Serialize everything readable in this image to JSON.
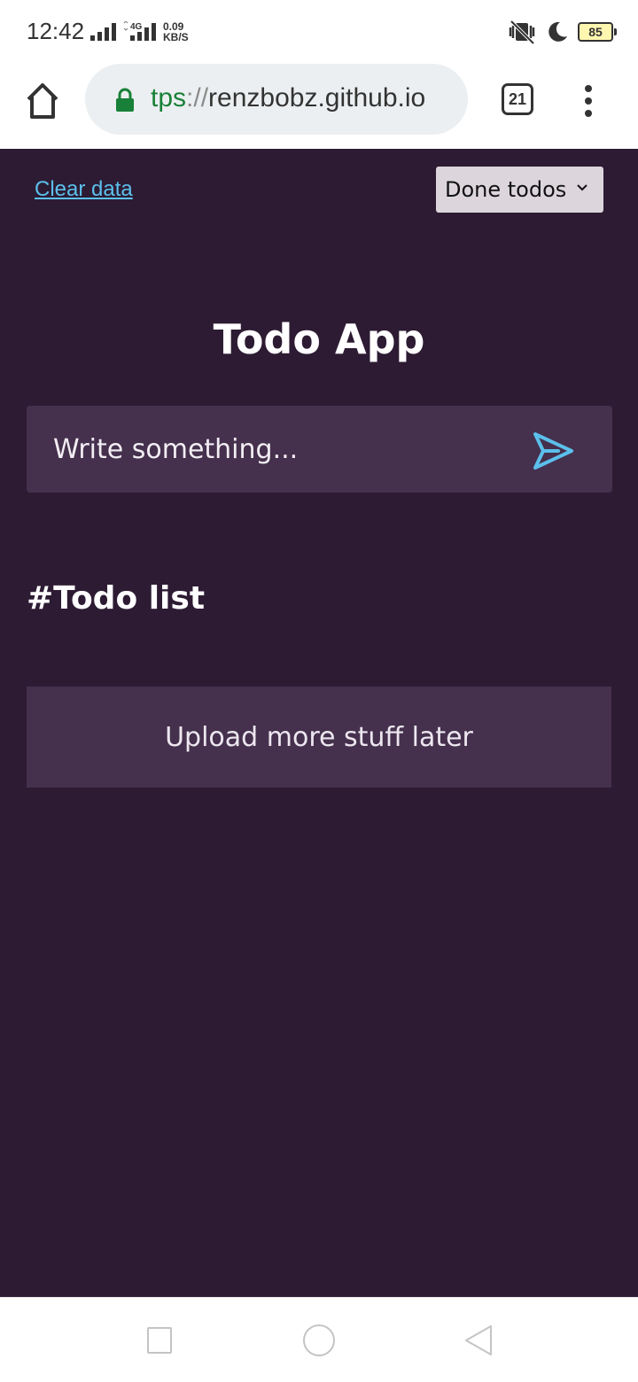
{
  "status_bar": {
    "time": "12:42",
    "network_type": "4G",
    "speed_value": "0.09",
    "speed_unit": "KB/S",
    "battery": "85",
    "icons": [
      "signal-icon",
      "mobile-data-icon",
      "vibrate-off-icon",
      "moon-icon",
      "battery-icon"
    ]
  },
  "browser": {
    "url_scheme": "tps",
    "url_sep": "://",
    "url_host": "renzbobz.github.io",
    "tab_count": "21",
    "icons": [
      "home-icon",
      "lock-icon",
      "tabs-icon",
      "more-vert-icon"
    ]
  },
  "app": {
    "clear_label": "Clear data",
    "filter_label": "Done todos",
    "title": "Todo App",
    "input_placeholder": "Write something...",
    "section_title": "#Todo list",
    "todos": [
      "Upload more stuff later"
    ],
    "accent_color": "#5bc0eb",
    "background_color": "#2d1b33"
  },
  "nav": {
    "icons": [
      "recents-icon",
      "home-circle-icon",
      "back-icon"
    ]
  }
}
